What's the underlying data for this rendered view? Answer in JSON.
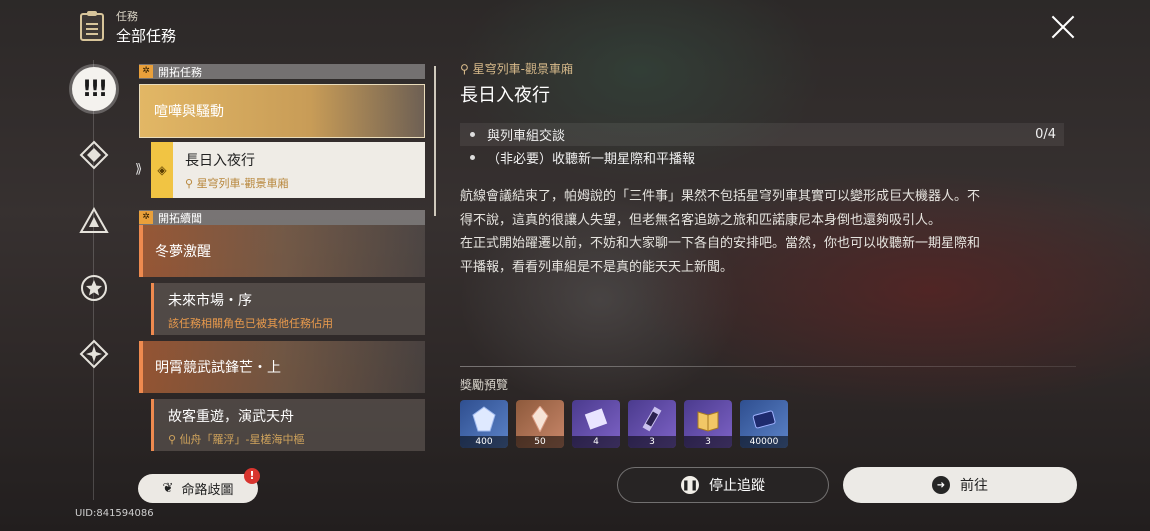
{
  "header": {
    "section": "任務",
    "title": "全部任務"
  },
  "rail": [
    {
      "icon": "all-quests-icon",
      "glyph": "!!!"
    },
    {
      "icon": "diamond-star-icon"
    },
    {
      "icon": "triangle-star-icon"
    },
    {
      "icon": "star-icon"
    },
    {
      "icon": "four-point-star-icon"
    }
  ],
  "list": {
    "section1": {
      "badge": "✲",
      "label": "開拓任務"
    },
    "section2": {
      "badge": "✲",
      "label": "開拓續聞"
    },
    "items": [
      {
        "title": "喧嘩與騷動"
      },
      {
        "title": "長日入夜行",
        "location": "星穹列車-觀景車廂"
      },
      {
        "title": "冬夢激醒"
      },
      {
        "title": "未來市場・序",
        "warning": "該任務相關角色已被其他任務佔用"
      },
      {
        "title": "明霄競武試鋒芒・上"
      },
      {
        "title": "故客重遊，演武天舟",
        "location": "仙舟「羅浮」-星槎海中樞"
      }
    ]
  },
  "detail": {
    "location": "星穹列車-觀景車廂",
    "title": "長日入夜行",
    "objectives": [
      {
        "text": "與列車組交談",
        "count": "0/4"
      },
      {
        "text": "（非必要）收聽新一期星際和平播報",
        "count": ""
      }
    ],
    "description": [
      "航線會議結束了，帕姆說的「三件事」果然不包括星穹列車其實可以變形成巨大機器人。不",
      "得不說，這真的很讓人失望，但老無名客追跡之旅和匹諾康尼本身倒也還夠吸引人。",
      "在正式開始躍遷以前，不妨和大家聊一下各自的安排吧。當然，你也可以收聽新一期星際和",
      "平播報，看看列車組是不是真的能天天上新聞。"
    ],
    "rewards_label": "獎勵預覽",
    "rewards": [
      {
        "count": "400",
        "icon": "stellar-jade-icon",
        "color": "blue"
      },
      {
        "count": "50",
        "icon": "crystal-icon",
        "color": "orange"
      },
      {
        "count": "4",
        "icon": "ticket-icon",
        "color": "purple"
      },
      {
        "count": "3",
        "icon": "refinement-icon",
        "color": "purple"
      },
      {
        "count": "3",
        "icon": "book-icon",
        "color": "purple"
      },
      {
        "count": "40000",
        "icon": "credit-icon",
        "color": "blue"
      }
    ]
  },
  "buttons": {
    "path_map": "命路歧圖",
    "path_map_badge": "!",
    "stop_tracking": "停止追蹤",
    "go": "前往"
  },
  "uid": "UID:841594086"
}
